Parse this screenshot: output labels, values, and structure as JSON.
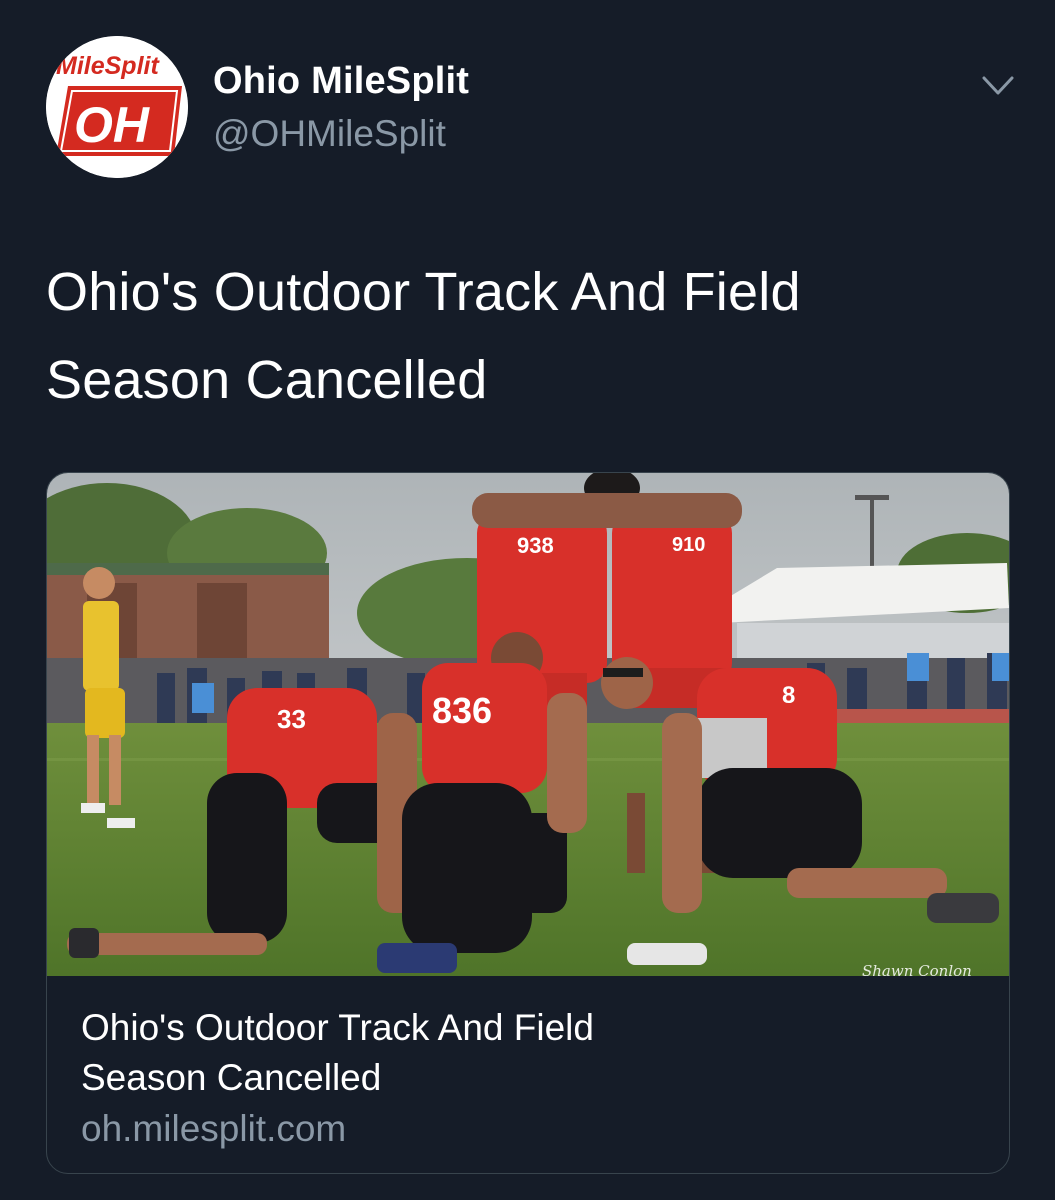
{
  "author": {
    "display_name": "Ohio MileSplit",
    "handle": "@OHMileSplit",
    "avatar_logo_top": "MileSplit",
    "avatar_logo_bottom": "OH"
  },
  "tweet": {
    "text_line_1": "Ohio's Outdoor Track And Field",
    "text_line_2": "Season Cancelled"
  },
  "link_card": {
    "title_line_1": "Ohio's Outdoor Track And Field",
    "title_line_2": "Season Cancelled",
    "domain": "oh.milesplit.com",
    "image": {
      "bib_numbers": [
        "938",
        "910",
        "33",
        "836",
        "8"
      ],
      "photo_credit": "Shawn Conlon"
    }
  },
  "icons": {
    "menu": "chevron-down-icon"
  },
  "colors": {
    "background": "#151c28",
    "text_primary": "#ffffff",
    "text_secondary": "#8a98a6",
    "card_border": "#38444d",
    "brand_red": "#d42a20"
  }
}
